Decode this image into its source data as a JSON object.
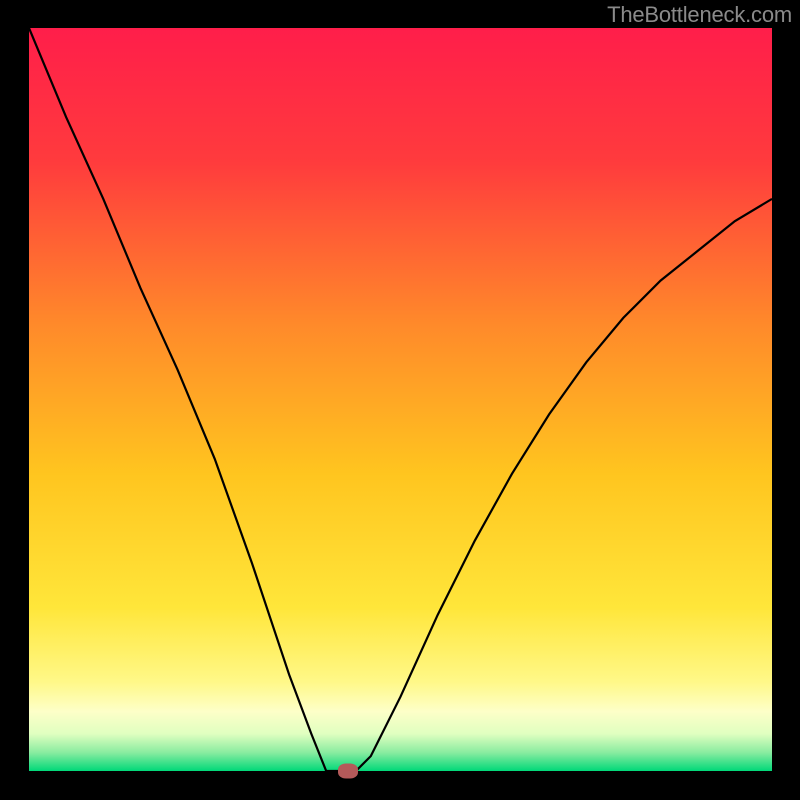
{
  "attribution": "TheBottleneck.com",
  "chart_data": {
    "type": "line",
    "title": "",
    "xlabel": "",
    "ylabel": "",
    "xlim": [
      0,
      100
    ],
    "ylim": [
      0,
      100
    ],
    "series": [
      {
        "name": "bottleneck-curve",
        "x": [
          0,
          5,
          10,
          15,
          20,
          25,
          30,
          35,
          38,
          40,
          42,
          44,
          46,
          47,
          50,
          55,
          60,
          65,
          70,
          75,
          80,
          85,
          90,
          95,
          100
        ],
        "y": [
          100,
          88,
          77,
          65,
          54,
          42,
          28,
          13,
          5,
          0,
          0,
          0,
          2,
          4,
          10,
          21,
          31,
          40,
          48,
          55,
          61,
          66,
          70,
          74,
          77
        ]
      }
    ],
    "marker": {
      "x": 43,
      "y": 0,
      "color": "#b45a5a"
    },
    "background_gradient": {
      "stops": [
        {
          "pos": 0.0,
          "color": "#ff1e4a"
        },
        {
          "pos": 0.18,
          "color": "#ff3b3d"
        },
        {
          "pos": 0.4,
          "color": "#ff8a2a"
        },
        {
          "pos": 0.6,
          "color": "#ffc51f"
        },
        {
          "pos": 0.78,
          "color": "#ffe63a"
        },
        {
          "pos": 0.88,
          "color": "#fff888"
        },
        {
          "pos": 0.92,
          "color": "#fdffc8"
        },
        {
          "pos": 0.95,
          "color": "#e0ffc0"
        },
        {
          "pos": 0.975,
          "color": "#8aeca0"
        },
        {
          "pos": 1.0,
          "color": "#00d879"
        }
      ]
    }
  }
}
